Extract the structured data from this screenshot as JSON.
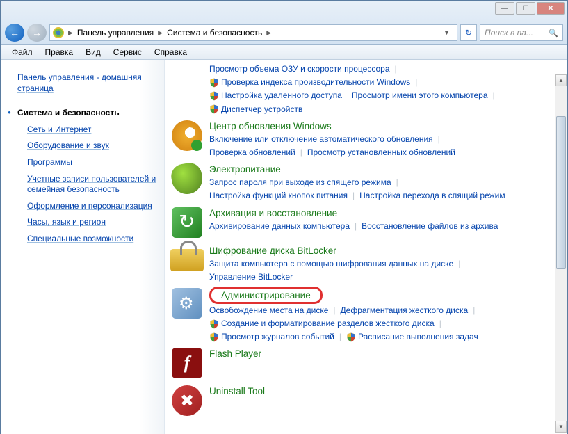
{
  "breadcrumb": {
    "seg1": "Панель управления",
    "seg2": "Система и безопасность"
  },
  "search": {
    "placeholder": "Поиск в па..."
  },
  "menu": {
    "file": "Файл",
    "edit": "Правка",
    "view": "Вид",
    "tools": "Сервис",
    "help": "Справка"
  },
  "sidebar": {
    "home": "Панель управления - домашняя страница",
    "items": [
      "Система и безопасность",
      "Сеть и Интернет",
      "Оборудование и звук",
      "Программы",
      "Учетные записи пользователей и семейная безопасность",
      "Оформление и персонализация",
      "Часы, язык и регион",
      "Специальные возможности"
    ]
  },
  "topLinks": {
    "l1": "Просмотр объема ОЗУ и скорости процессора",
    "l2": "Проверка индекса производительности Windows",
    "l3": "Настройка удаленного доступа",
    "l4": "Просмотр имени этого компьютера",
    "l5": "Диспетчер устройств"
  },
  "sections": {
    "wu": {
      "title": "Центр обновления Windows",
      "l1": "Включение или отключение автоматического обновления",
      "l2": "Проверка обновлений",
      "l3": "Просмотр установленных обновлений"
    },
    "power": {
      "title": "Электропитание",
      "l1": "Запрос пароля при выходе из спящего режима",
      "l2": "Настройка функций кнопок питания",
      "l3": "Настройка перехода в спящий режим"
    },
    "backup": {
      "title": "Архивация и восстановление",
      "l1": "Архивирование данных компьютера",
      "l2": "Восстановление файлов из архива"
    },
    "bitlocker": {
      "title": "Шифрование диска BitLocker",
      "l1": "Защита компьютера с помощью шифрования данных на диске",
      "l2": "Управление BitLocker"
    },
    "admin": {
      "title": "Администрирование",
      "l1": "Освобождение места на диске",
      "l2": "Дефрагментация жесткого диска",
      "l3": "Создание и форматирование разделов жесткого диска",
      "l4": "Просмотр журналов событий",
      "l5": "Расписание выполнения задач"
    },
    "flash": {
      "title": "Flash Player"
    },
    "uninstall": {
      "title": "Uninstall Tool"
    }
  }
}
